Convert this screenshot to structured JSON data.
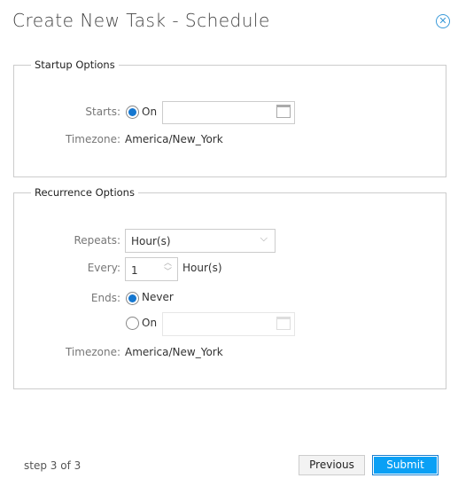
{
  "header": {
    "title": "Create New Task - Schedule",
    "close_icon": "close-circle-icon"
  },
  "startup": {
    "legend": "Startup Options",
    "starts_label": "Starts:",
    "starts_option": "On",
    "starts_value": "",
    "timezone_label": "Timezone:",
    "timezone_value": "America/New_York"
  },
  "recurrence": {
    "legend": "Recurrence Options",
    "repeats_label": "Repeats:",
    "repeats_value": "Hour(s)",
    "every_label": "Every:",
    "every_value": "1",
    "every_unit": "Hour(s)",
    "ends_label": "Ends:",
    "ends_never": "Never",
    "ends_on": "On",
    "ends_on_value": "",
    "ends_selected": "Never",
    "timezone_label": "Timezone:",
    "timezone_value": "America/New_York"
  },
  "footer": {
    "step": "step 3 of 3",
    "previous": "Previous",
    "submit": "Submit"
  },
  "colors": {
    "accent": "#0aa0f5",
    "radio": "#1577d0"
  }
}
